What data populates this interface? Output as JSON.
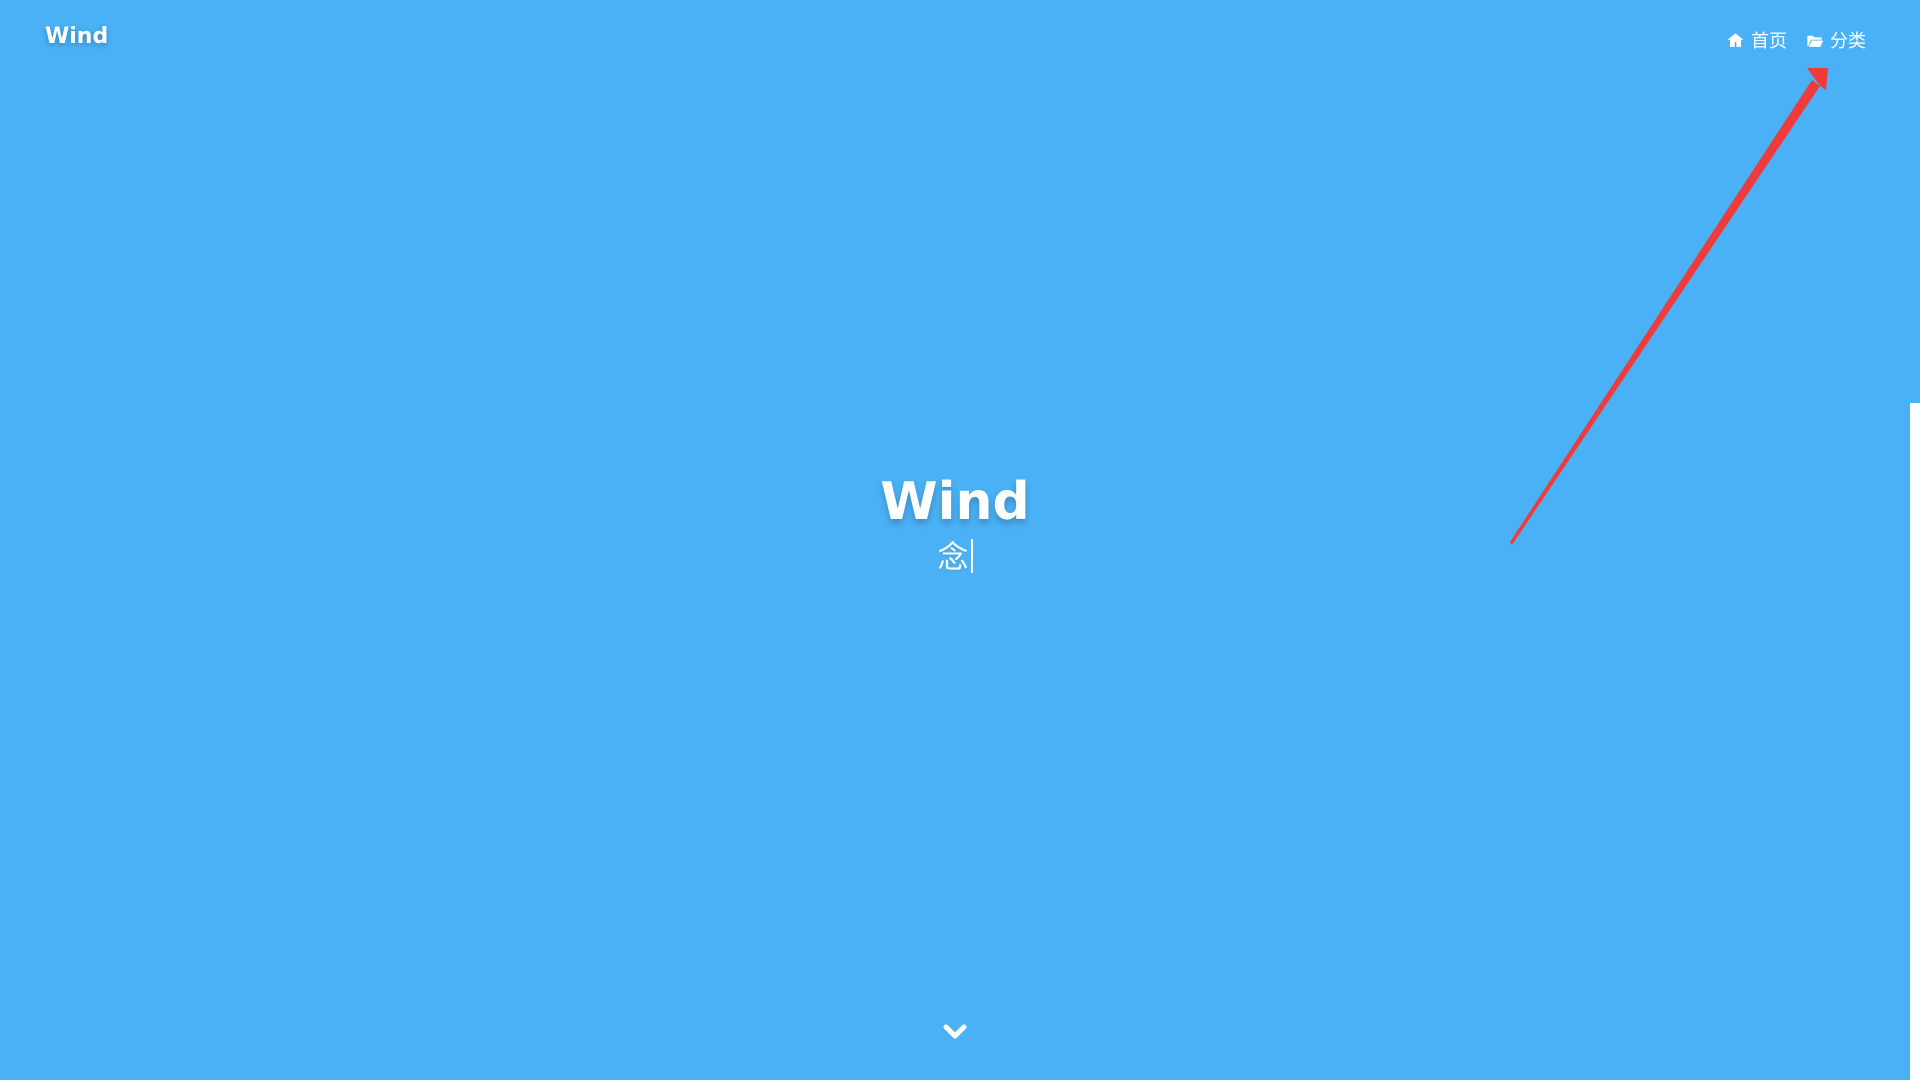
{
  "site": {
    "brand": "Wind",
    "title": "Wind",
    "subtitle": "念"
  },
  "nav": {
    "home": {
      "label": "首页",
      "icon": "home-icon"
    },
    "categories": {
      "label": "分类",
      "icon": "folder-open-icon"
    }
  },
  "hero": {
    "scroll_icon": "chevron-down-icon"
  },
  "annotation": {
    "color": "#ef3b3b",
    "type": "red-arrow"
  },
  "colors": {
    "background": "#4ab1f6",
    "text": "#ffffff"
  }
}
